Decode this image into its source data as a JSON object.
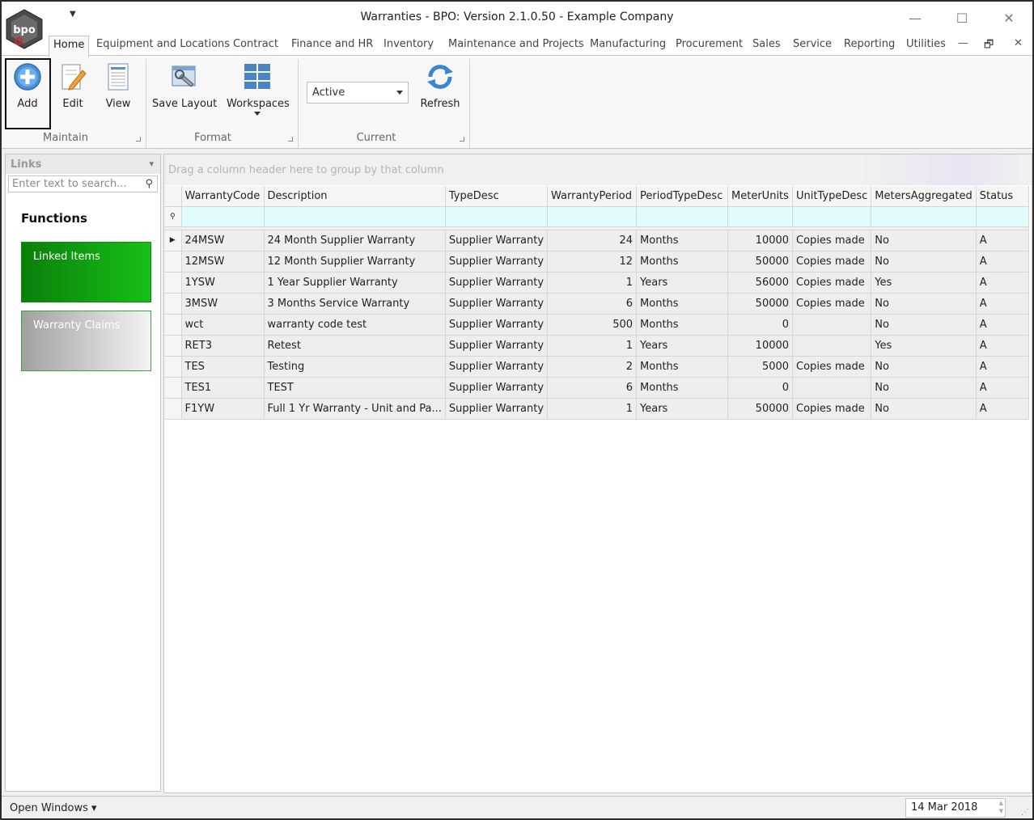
{
  "window": {
    "title": "Warranties - BPO: Version 2.1.0.50 - Example Company",
    "logo_text": "bpo",
    "qat_glyph": "▼",
    "minimize_glyph": "—",
    "maximize_glyph": "☐",
    "close_glyph": "✕"
  },
  "tabs": [
    "Home",
    "Equipment and Locations",
    "Contract",
    "Finance and HR",
    "Inventory",
    "Maintenance and Projects",
    "Manufacturing",
    "Procurement",
    "Sales",
    "Service",
    "Reporting",
    "Utilities"
  ],
  "mdi": {
    "minimize": "—",
    "restore": "🗗",
    "close": "✕"
  },
  "ribbon": {
    "maintain": {
      "add": "Add",
      "edit": "Edit",
      "view": "View",
      "group": "Maintain"
    },
    "format": {
      "save_layout": "Save Layout",
      "workspaces": "Workspaces",
      "group": "Format"
    },
    "current": {
      "status_value": "Active",
      "refresh": "Refresh",
      "group": "Current"
    }
  },
  "links": {
    "header": "Links",
    "pin": "📌",
    "search_placeholder": "Enter text to search...",
    "functions_title": "Functions",
    "tiles": [
      "Linked Items",
      "Warranty Claims"
    ]
  },
  "grid": {
    "group_hint": "Drag a column header here to group by that column",
    "columns": [
      "WarrantyCode",
      "Description",
      "TypeDesc",
      "WarrantyPeriod",
      "PeriodTypeDesc",
      "MeterUnits",
      "UnitTypeDesc",
      "MetersAggregated",
      "Status"
    ],
    "rows": [
      [
        "24MSW",
        "24 Month Supplier Warranty",
        "Supplier Warranty",
        "24",
        "Months",
        "10000",
        "Copies made",
        "No",
        "A"
      ],
      [
        "12MSW",
        "12 Month Supplier Warranty",
        "Supplier Warranty",
        "12",
        "Months",
        "50000",
        "Copies made",
        "No",
        "A"
      ],
      [
        "1YSW",
        "1 Year Supplier Warranty",
        "Supplier Warranty",
        "1",
        "Years",
        "56000",
        "Copies made",
        "Yes",
        "A"
      ],
      [
        "3MSW",
        "3 Months Service Warranty",
        "Supplier Warranty",
        "6",
        "Months",
        "50000",
        "Copies made",
        "No",
        "A"
      ],
      [
        "wct",
        "warranty code test",
        "Supplier Warranty",
        "500",
        "Months",
        "0",
        "",
        "No",
        "A"
      ],
      [
        "RET3",
        "Retest",
        "Supplier Warranty",
        "1",
        "Years",
        "10000",
        "",
        "Yes",
        "A"
      ],
      [
        "TES",
        "Testing",
        "Supplier Warranty",
        "2",
        "Months",
        "5000",
        "Copies made",
        "No",
        "A"
      ],
      [
        "TES1",
        "TEST",
        "Supplier Warranty",
        "6",
        "Months",
        "0",
        "",
        "No",
        "A"
      ],
      [
        "F1YW",
        "Full 1 Yr Warranty - Unit and Pa...",
        "Supplier Warranty",
        "1",
        "Years",
        "50000",
        "Copies made",
        "No",
        "A"
      ]
    ]
  },
  "statusbar": {
    "open_windows": "Open Windows ▾",
    "date": "14 Mar 2018"
  }
}
